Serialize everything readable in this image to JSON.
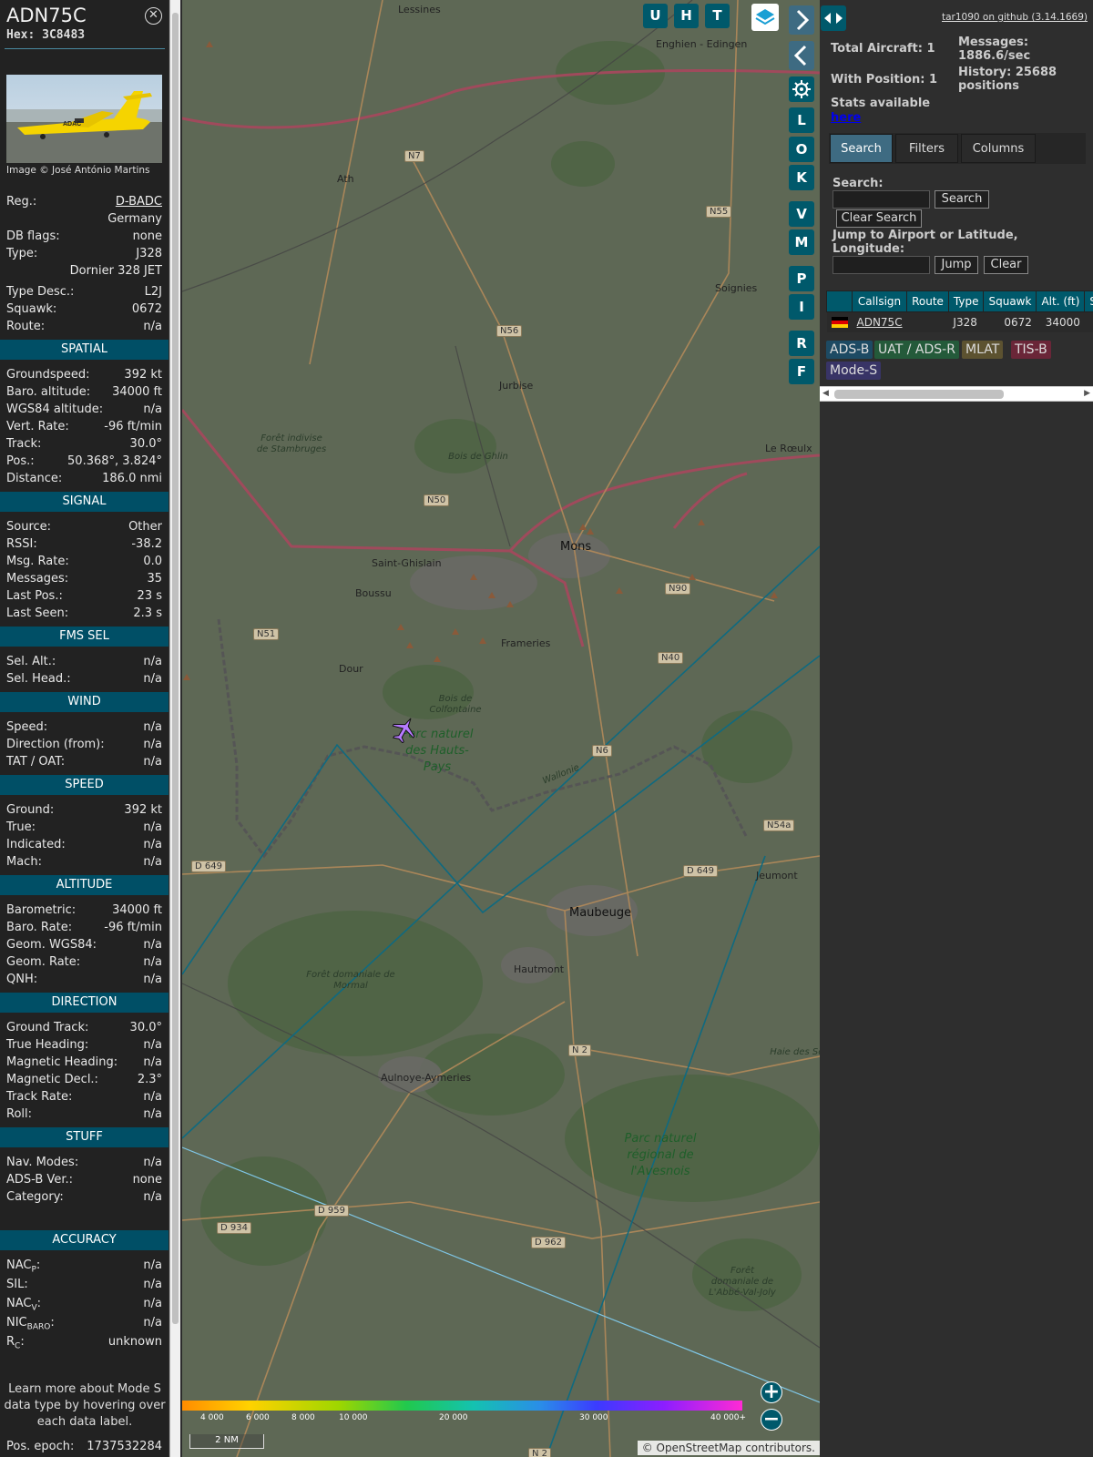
{
  "selected": {
    "callsign": "ADN75C",
    "hex_label": "Hex:",
    "hex": "3C8483",
    "close_icon": "close-circle-icon",
    "photo_credit": "Image © José António Martins",
    "photo_logo": "ADAC"
  },
  "info": [
    {
      "label": "Reg.:",
      "value": "D-BADC",
      "link": true
    },
    {
      "label": "",
      "value": "Germany"
    },
    {
      "label": "DB flags:",
      "value": "none"
    },
    {
      "label": "Type:",
      "value": "J328"
    },
    {
      "label": "",
      "value": "Dornier 328 JET"
    },
    {
      "label": "Type Desc.:",
      "value": "L2J"
    },
    {
      "label": "Squawk:",
      "value": "0672"
    },
    {
      "label": "Route:",
      "value": "n/a"
    }
  ],
  "sections": {
    "spatial": {
      "title": "SPATIAL",
      "rows": [
        {
          "label": "Groundspeed:",
          "value": "392 kt"
        },
        {
          "label": "Baro. altitude:",
          "value": "34000 ft"
        },
        {
          "label": "WGS84 altitude:",
          "value": "n/a"
        },
        {
          "label": "Vert. Rate:",
          "value": "-96 ft/min"
        },
        {
          "label": "Track:",
          "value": "30.0°"
        },
        {
          "label": "Pos.:",
          "value": "50.368°, 3.824°"
        },
        {
          "label": "Distance:",
          "value": "186.0 nmi"
        }
      ]
    },
    "signal": {
      "title": "SIGNAL",
      "rows": [
        {
          "label": "Source:",
          "value": "Other"
        },
        {
          "label": "RSSI:",
          "value": "-38.2"
        },
        {
          "label": "Msg. Rate:",
          "value": "0.0"
        },
        {
          "label": "Messages:",
          "value": "35"
        },
        {
          "label": "Last Pos.:",
          "value": "23 s"
        },
        {
          "label": "Last Seen:",
          "value": "2.3 s"
        }
      ]
    },
    "fms": {
      "title": "FMS SEL",
      "rows": [
        {
          "label": "Sel. Alt.:",
          "value": "n/a"
        },
        {
          "label": "Sel. Head.:",
          "value": "n/a"
        }
      ]
    },
    "wind": {
      "title": "WIND",
      "rows": [
        {
          "label": "Speed:",
          "value": "n/a"
        },
        {
          "label": "Direction (from):",
          "value": "n/a"
        },
        {
          "label": "TAT / OAT:",
          "value": "n/a"
        }
      ]
    },
    "speed": {
      "title": "SPEED",
      "rows": [
        {
          "label": "Ground:",
          "value": "392 kt"
        },
        {
          "label": "True:",
          "value": "n/a"
        },
        {
          "label": "Indicated:",
          "value": "n/a"
        },
        {
          "label": "Mach:",
          "value": "n/a"
        }
      ]
    },
    "altitude": {
      "title": "ALTITUDE",
      "rows": [
        {
          "label": "Barometric:",
          "value": "34000 ft"
        },
        {
          "label": "Baro. Rate:",
          "value": "-96 ft/min"
        },
        {
          "label": "Geom. WGS84:",
          "value": "n/a"
        },
        {
          "label": "Geom. Rate:",
          "value": "n/a"
        },
        {
          "label": "QNH:",
          "value": "n/a"
        }
      ]
    },
    "direction": {
      "title": "DIRECTION",
      "rows": [
        {
          "label": "Ground Track:",
          "value": "30.0°"
        },
        {
          "label": "True Heading:",
          "value": "n/a"
        },
        {
          "label": "Magnetic Heading:",
          "value": "n/a"
        },
        {
          "label": "Magnetic Decl.:",
          "value": "2.3°"
        },
        {
          "label": "Track Rate:",
          "value": "n/a"
        },
        {
          "label": "Roll:",
          "value": "n/a"
        }
      ]
    },
    "stuff": {
      "title": "STUFF",
      "rows": [
        {
          "label": "Nav. Modes:",
          "value": "n/a"
        },
        {
          "label": "ADS-B Ver.:",
          "value": "none"
        },
        {
          "label": "Category:",
          "value": "n/a"
        }
      ]
    },
    "accuracy": {
      "title": "ACCURACY",
      "rows": [
        {
          "label": "NAC",
          "sub": "P",
          "value": "n/a"
        },
        {
          "label": "SIL:",
          "value": "n/a"
        },
        {
          "label": "NAC",
          "sub": "V",
          "value": "n/a"
        },
        {
          "label": "NIC",
          "sub": "BARO",
          "value": "n/a"
        },
        {
          "label": "R",
          "sub": "C",
          "value": "unknown"
        }
      ]
    }
  },
  "learn_more": "Learn more about Mode S data type by hovering over each data label.",
  "pos_epoch": {
    "label": "Pos. epoch:",
    "value": "1737532284"
  },
  "map": {
    "top_buttons": [
      "U",
      "H",
      "T"
    ],
    "layers_icon": "layers-icon",
    "side_buttons": [
      "L",
      "O",
      "K",
      "V",
      "M",
      "P",
      "I",
      "R",
      "F"
    ],
    "icons": {
      "expand": "chevron-right-icon",
      "collapse": "chevron-left-icon",
      "settings": "gear-icon",
      "toggle_width": "left-right-arrows-icon",
      "aircraft": "airplane-icon",
      "zoom_in": "plus-icon",
      "zoom_out": "minus-icon"
    },
    "cities": [
      "Lessines",
      "Enghien - Edingen",
      "Ath",
      "Soignies",
      "Jurbise",
      "Le Rœulx",
      "Mons",
      "Saint-Ghislain",
      "Boussu",
      "Frameries",
      "Dour",
      "Maubeuge",
      "Jeumont",
      "Hautmont",
      "Aulnoye-Aymeries"
    ],
    "small_labels": [
      "Forêt indivise de Stambruges",
      "Bois de Ghlin",
      "Bois de Colfontaine",
      "Wallonie",
      "Forêt domaniale de Mormal",
      "Haie des Soules",
      "Forêt domaniale de L'Abbé-Val-Joly"
    ],
    "parks": [
      "Parc naturel des Hauts-Pays",
      "Parc naturel régional de l'Avesnois"
    ],
    "roads": [
      "N7",
      "N55",
      "N56",
      "N50",
      "N90",
      "N51",
      "N40",
      "N6",
      "N54a",
      "D 649",
      "D 649",
      "N 2",
      "D 959",
      "D 934",
      "D 962",
      "N 2"
    ],
    "colorbar_ticks": [
      "4 000",
      "6 000",
      "8 000",
      "10 000",
      "20 000",
      "30 000",
      "40 000+"
    ],
    "scale": "2 NM",
    "attribution": "© OpenStreetMap contributors."
  },
  "right": {
    "github_link": "tar1090 on github (3.14.1669)",
    "total_aircraft": "Total Aircraft: 1",
    "with_position": "With Position: 1",
    "stats_available": "Stats available",
    "stats_link": "here",
    "messages_label": "Messages:",
    "messages_value": "1886.6/sec",
    "history_label": "History: 25688",
    "history_unit": "positions",
    "tabs": [
      "Search",
      "Filters",
      "Columns"
    ],
    "search_label": "Search:",
    "search_button": "Search",
    "clear_search_button": "Clear Search",
    "jump_label": "Jump to Airport or Latitude, Longitude:",
    "jump_button": "Jump",
    "clear_button": "Clear",
    "table_headers": [
      "",
      "Callsign",
      "Route",
      "Type",
      "Squawk",
      "Alt. (ft)",
      "Spd."
    ],
    "table_rows": [
      {
        "flag": "flag-germany-icon",
        "callsign": "ADN75C",
        "route": "",
        "type": "J328",
        "squawk": "0672",
        "alt": "34000",
        "spd": ""
      }
    ],
    "legend": [
      {
        "label": "ADS-B",
        "color": "#1d4a63"
      },
      {
        "label": "UAT / ADS-R",
        "color": "#245a3a"
      },
      {
        "label": "MLAT",
        "color": "#5c5230"
      },
      {
        "label": "TIS-B",
        "color": "#6a2638"
      },
      {
        "label": "Mode-S",
        "color": "#383466"
      }
    ]
  }
}
